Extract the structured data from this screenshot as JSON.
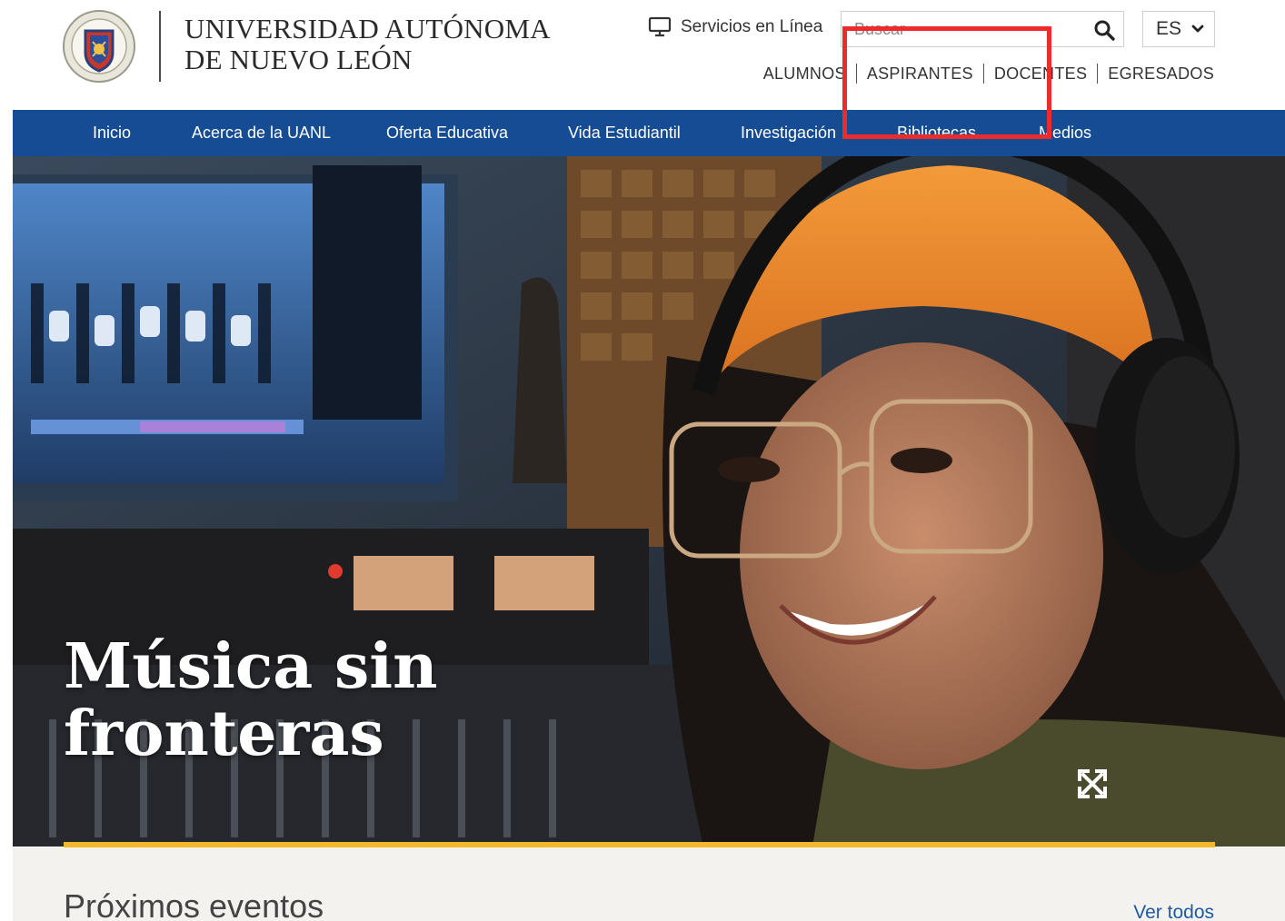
{
  "header": {
    "university_name_line1": "UNIVERSIDAD AUTÓNOMA",
    "university_name_line2": "DE NUEVO LEÓN",
    "seal_text": "UNIVERSIDAD AUTÓNOMA DE NUEVO LEÓN",
    "servicios_label": "Servicios en Línea",
    "search": {
      "placeholder": "Buscar",
      "value": ""
    },
    "language": "ES",
    "audiences": [
      "ALUMNOS",
      "ASPIRANTES",
      "DOCENTES",
      "EGRESADOS"
    ]
  },
  "nav": {
    "items": [
      "Inicio",
      "Acerca de la UANL",
      "Oferta Educativa",
      "Vida Estudiantil",
      "Investigación",
      "Bibliotecas",
      "Medios"
    ]
  },
  "hero": {
    "title_line1": "Música sin",
    "title_line2": "fronteras"
  },
  "events": {
    "title": "Próximos eventos",
    "see_all": "Ver todos"
  },
  "colors": {
    "nav_blue": "#154c93",
    "accent_gold": "#f4b92a",
    "highlight_red": "#ef2a2a",
    "link_blue": "#1d5aa5"
  },
  "icons": [
    "monitor-icon",
    "search-icon",
    "chevron-down-icon",
    "expand-icon",
    "university-seal-logo"
  ]
}
